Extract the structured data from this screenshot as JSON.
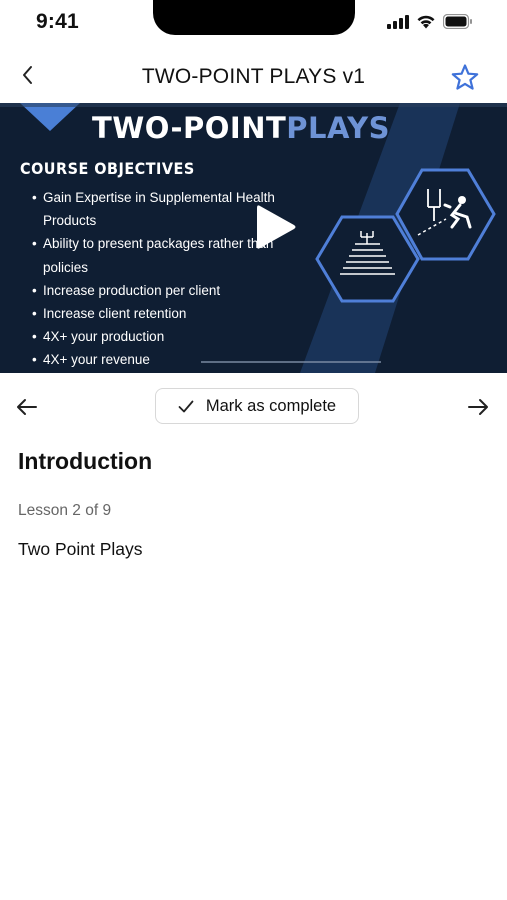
{
  "status_bar": {
    "time": "9:41"
  },
  "nav": {
    "title": "TWO-POINT PLAYS v1"
  },
  "video": {
    "title_white": "TWO-POINT",
    "title_blue": "PLAYS",
    "objectives_heading": "COURSE OBJECTIVES",
    "objectives": [
      "Gain Expertise in Supplemental Health",
      "Products",
      "Ability to present packages rather than",
      "policies",
      "Increase production per client",
      "Increase client retention",
      "4X+ your production",
      "4X+ your revenue"
    ]
  },
  "controls": {
    "mark_complete_label": "Mark as complete"
  },
  "lesson": {
    "heading": "Introduction",
    "position": "Lesson 2 of 9",
    "description": "Two Point Plays"
  },
  "colors": {
    "accent": "#3f72d9",
    "video_bg": "#0f1e33",
    "video_blue": "#6e93d6"
  }
}
